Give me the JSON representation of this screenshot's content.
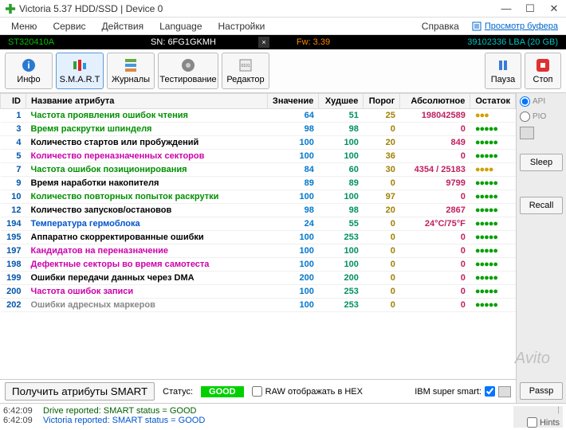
{
  "window": {
    "title": "Victoria 5.37 HDD/SSD | Device 0"
  },
  "menu": {
    "items": [
      "Меню",
      "Сервис",
      "Действия",
      "Language",
      "Настройки"
    ],
    "help": "Справка",
    "buffer": "Просмотр буфера"
  },
  "device": {
    "model": "ST320410A",
    "sn": "SN: 6FG1GKMH",
    "fw": "Fw: 3.39",
    "size": "39102336 LBA (20 GB)"
  },
  "toolbar": {
    "info": "Инфо",
    "smart": "S.M.A.R.T",
    "journals": "Журналы",
    "testing": "Тестирование",
    "editor": "Редактор",
    "pause": "Пауза",
    "stop": "Стоп"
  },
  "table": {
    "headers": {
      "id": "ID",
      "name": "Название атрибута",
      "value": "Значение",
      "worst": "Худшее",
      "threshold": "Порог",
      "raw": "Абсолютное",
      "health": "Остаток"
    },
    "rows": [
      {
        "id": "1",
        "name": "Частота проявления ошибок чтения",
        "cls": "green",
        "v": "64",
        "w": "51",
        "t": "25",
        "r": "198042589",
        "hc": "y",
        "hd": "●●●"
      },
      {
        "id": "3",
        "name": "Время раскрутки шпинделя",
        "cls": "green",
        "v": "98",
        "w": "98",
        "t": "0",
        "r": "0",
        "hc": "g",
        "hd": "●●●●●"
      },
      {
        "id": "4",
        "name": "Количество стартов или пробуждений",
        "cls": "black",
        "v": "100",
        "w": "100",
        "t": "20",
        "r": "849",
        "hc": "g",
        "hd": "●●●●●"
      },
      {
        "id": "5",
        "name": "Количество переназначенных секторов",
        "cls": "magenta",
        "v": "100",
        "w": "100",
        "t": "36",
        "r": "0",
        "hc": "g",
        "hd": "●●●●●"
      },
      {
        "id": "7",
        "name": "Частота ошибок позиционирования",
        "cls": "green",
        "v": "84",
        "w": "60",
        "t": "30",
        "r": "4354 / 25183",
        "hc": "y",
        "hd": "●●●●"
      },
      {
        "id": "9",
        "name": "Время наработки накопителя",
        "cls": "black",
        "v": "89",
        "w": "89",
        "t": "0",
        "r": "9799",
        "hc": "g",
        "hd": "●●●●●"
      },
      {
        "id": "10",
        "name": "Количество повторных попыток раскрутки",
        "cls": "green",
        "v": "100",
        "w": "100",
        "t": "97",
        "r": "0",
        "hc": "g",
        "hd": "●●●●●"
      },
      {
        "id": "12",
        "name": "Количество запусков/остановов",
        "cls": "black",
        "v": "98",
        "w": "98",
        "t": "20",
        "r": "2867",
        "hc": "g",
        "hd": "●●●●●"
      },
      {
        "id": "194",
        "name": "Температура гермоблока",
        "cls": "blue",
        "v": "24",
        "w": "55",
        "t": "0",
        "r": "24°C/75°F",
        "hc": "g",
        "hd": "●●●●●"
      },
      {
        "id": "195",
        "name": "Аппаратно скорректированные ошибки",
        "cls": "black",
        "v": "100",
        "w": "253",
        "t": "0",
        "r": "0",
        "hc": "g",
        "hd": "●●●●●"
      },
      {
        "id": "197",
        "name": "Кандидатов на переназначение",
        "cls": "magenta",
        "v": "100",
        "w": "100",
        "t": "0",
        "r": "0",
        "hc": "g",
        "hd": "●●●●●"
      },
      {
        "id": "198",
        "name": "Дефектные секторы во время самотеста",
        "cls": "magenta",
        "v": "100",
        "w": "100",
        "t": "0",
        "r": "0",
        "hc": "g",
        "hd": "●●●●●"
      },
      {
        "id": "199",
        "name": "Ошибки передачи данных через DMA",
        "cls": "black",
        "v": "200",
        "w": "200",
        "t": "0",
        "r": "0",
        "hc": "g",
        "hd": "●●●●●"
      },
      {
        "id": "200",
        "name": "Частота ошибок записи",
        "cls": "magenta",
        "v": "100",
        "w": "253",
        "t": "0",
        "r": "0",
        "hc": "g",
        "hd": "●●●●●"
      },
      {
        "id": "202",
        "name": "Ошибки адресных маркеров",
        "cls": "gray",
        "v": "100",
        "w": "253",
        "t": "0",
        "r": "0",
        "hc": "g",
        "hd": "●●●●●"
      }
    ]
  },
  "sidepanel": {
    "api": "API",
    "pio": "PIO",
    "sleep": "Sleep",
    "recall": "Recall",
    "passp": "Passp"
  },
  "bottom": {
    "get_smart": "Получить атрибуты SMART",
    "status_label": "Статус:",
    "status_value": "GOOD",
    "raw_hex": "RAW отображать в HEX",
    "ibm": "IBM super smart:"
  },
  "log": {
    "line1_time": "6:42:09",
    "line1_text": "Drive reported: SMART status = GOOD",
    "line2_time": "6:42:09",
    "line2_text": "Victoria reported: SMART status = GOOD",
    "hints": "Hints"
  },
  "watermark": "Avito"
}
